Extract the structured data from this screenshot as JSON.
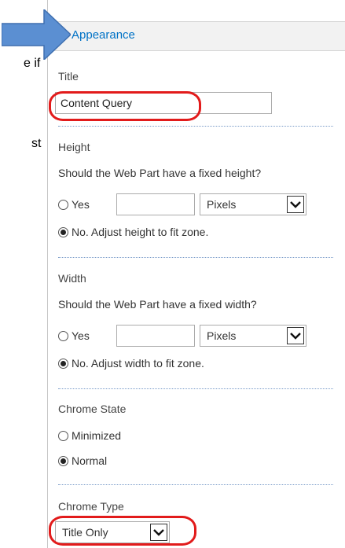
{
  "left_fragments": [
    "e if",
    "st"
  ],
  "panel": {
    "header_title": "Appearance"
  },
  "title_section": {
    "label": "Title",
    "value": "Content Query"
  },
  "height_section": {
    "label": "Height",
    "question": "Should the Web Part have a fixed height?",
    "yes_label": "Yes",
    "yes_value": "",
    "unit": "Pixels",
    "no_label": "No. Adjust height to fit zone.",
    "selected": "no"
  },
  "width_section": {
    "label": "Width",
    "question": "Should the Web Part have a fixed width?",
    "yes_label": "Yes",
    "yes_value": "",
    "unit": "Pixels",
    "no_label": "No. Adjust width to fit zone.",
    "selected": "no"
  },
  "chrome_state": {
    "label": "Chrome State",
    "options": [
      "Minimized",
      "Normal"
    ],
    "selected": "Normal"
  },
  "chrome_type": {
    "label": "Chrome Type",
    "value": "Title Only"
  },
  "colors": {
    "accent": "#0072c6",
    "arrow": "#5b8fd2",
    "highlight": "#e21b1b",
    "header_bg": "#f2f2f2"
  }
}
